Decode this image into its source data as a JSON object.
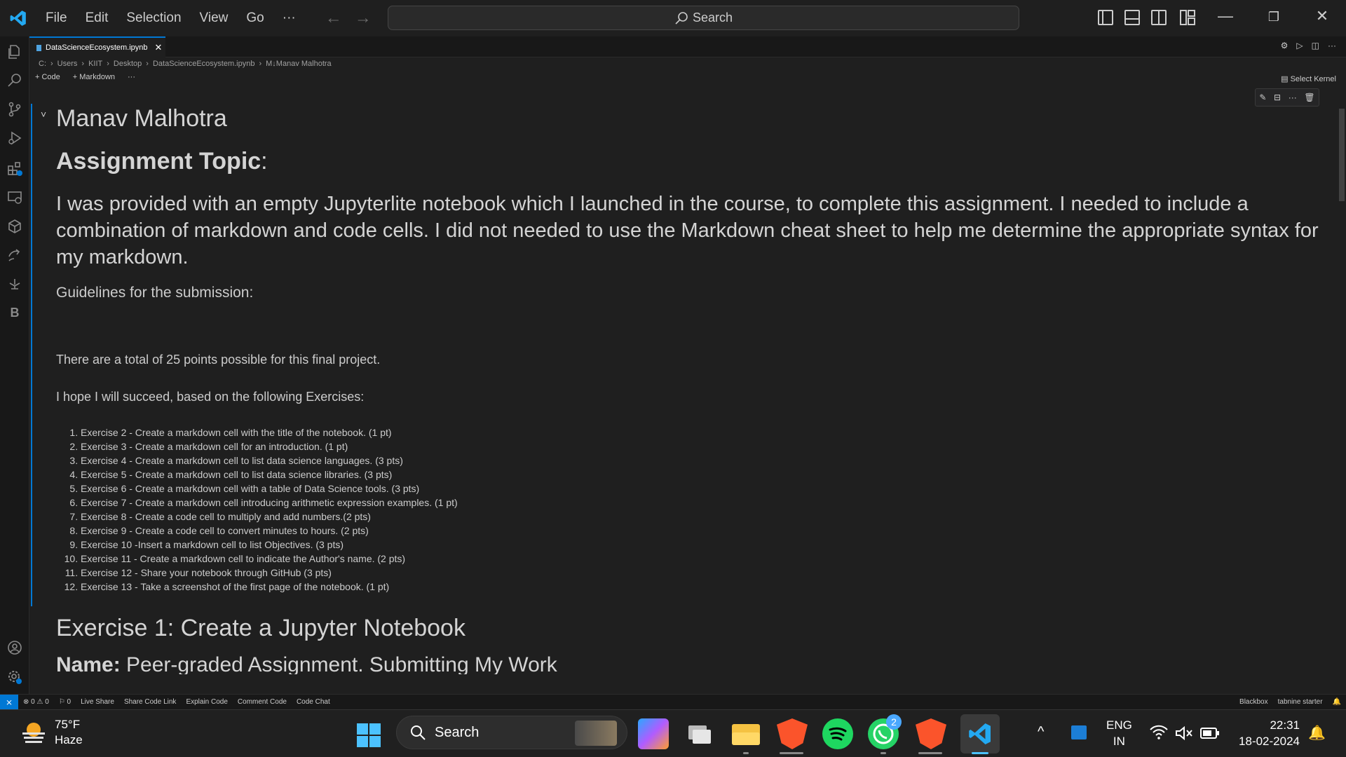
{
  "menu": [
    "File",
    "Edit",
    "Selection",
    "View",
    "Go",
    "···"
  ],
  "search": {
    "label": "Search"
  },
  "tab": {
    "filename": "DataScienceEcosystem.ipynb"
  },
  "breadcrumb": [
    "C:",
    "Users",
    "KIIT",
    "Desktop",
    "DataScienceEcosystem.ipynb",
    "M↓Manav Malhotra"
  ],
  "cell_toolbar": {
    "code": "Code",
    "markdown": "Markdown",
    "more": "···"
  },
  "kernel": {
    "label": "Select Kernel"
  },
  "notebook": {
    "author": "Manav Malhotra",
    "topic_bold": "Assignment Topic",
    "topic_colon": ":",
    "intro": "I was provided with an empty Jupyterlite notebook which I launched in the course, to complete this assignment. I needed to include a combination of markdown and code cells. I did not needed to use the Markdown cheat sheet to help me determine the appropriate syntax for my markdown.",
    "guidelines": "Guidelines for the submission:",
    "points": "There are a total of 25 points possible for this final project.",
    "hope": "I hope I will succeed, based on the following Exercises:",
    "exercises": [
      "Exercise 2 - Create a markdown cell with the title of the notebook. (1 pt)",
      "Exercise 3 - Create a markdown cell for an introduction. (1 pt)",
      "Exercise 4 - Create a markdown cell to list data science languages. (3 pts)",
      "Exercise 5 - Create a markdown cell to list data science libraries. (3 pts)",
      "Exercise 6 - Create a markdown cell with a table of Data Science tools. (3 pts)",
      "Exercise 7 - Create a markdown cell introducing arithmetic expression examples. (1 pt)",
      "Exercise 8 - Create a code cell to multiply and add numbers.(2 pts)",
      "Exercise 9 - Create a code cell to convert minutes to hours. (2 pts)",
      "Exercise 10 -Insert a markdown cell to list Objectives. (3 pts)",
      "Exercise 11 - Create a markdown cell to indicate the Author's name. (2 pts)",
      "Exercise 12 - Share your notebook through GitHub (3 pts)",
      "Exercise 13 - Take a screenshot of the first page of the notebook. (1 pt)"
    ],
    "exercise1_heading": "Exercise 1: Create a Jupyter Notebook",
    "name_bold": "Name:",
    "name_rest": " Peer-graded Assignment. Submitting My Work"
  },
  "statusbar": {
    "errors": "⊗ 0 ⚠ 0",
    "ports": "⚐ 0",
    "live_share": "Live Share",
    "share_code_link": "Share Code Link",
    "explain_code": "Explain Code",
    "comment_code": "Comment Code",
    "code_chat": "Code Chat",
    "blackbox": "Blackbox",
    "tabnine": "tabnine starter"
  },
  "taskbar": {
    "weather_temp": "75°F",
    "weather_desc": "Haze",
    "search_label": "Search",
    "whatsapp_badge": "2",
    "lang_top": "ENG",
    "lang_bottom": "IN",
    "time": "22:31",
    "date": "18-02-2024"
  },
  "colors": {
    "accent": "#0078d4",
    "editor_bg": "#1f1f1f"
  }
}
